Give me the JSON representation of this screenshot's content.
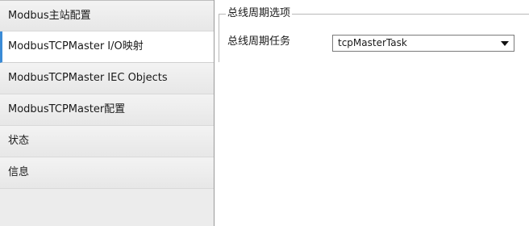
{
  "sidebar": {
    "items": [
      {
        "label": "Modbus主站配置",
        "selected": false
      },
      {
        "label": "ModbusTCPMaster I/O映射",
        "selected": true
      },
      {
        "label": "ModbusTCPMaster IEC Objects",
        "selected": false
      },
      {
        "label": "ModbusTCPMaster配置",
        "selected": false
      },
      {
        "label": "状态",
        "selected": false
      },
      {
        "label": "信息",
        "selected": false
      }
    ]
  },
  "main": {
    "group_title": "总线周期选项",
    "bus_cycle_task_label": "总线周期任务",
    "bus_cycle_task_value": "tcpMasterTask",
    "dropdown_icon": "chevron-down-icon"
  },
  "colors": {
    "selected_accent": "#3b8bd6",
    "sidebar_bg": "#ececec"
  }
}
